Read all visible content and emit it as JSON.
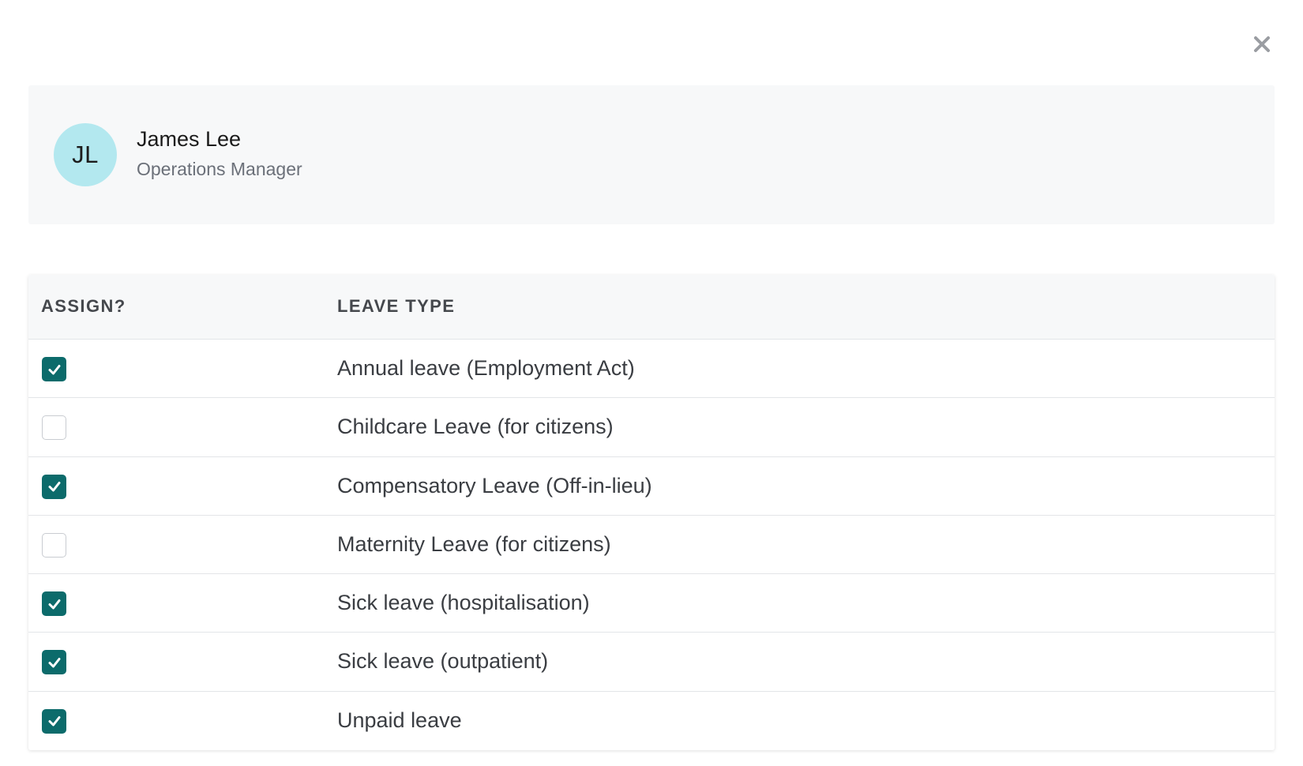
{
  "employee": {
    "initials": "JL",
    "name": "James Lee",
    "role": "Operations Manager",
    "avatar_color": "#b3e8ef"
  },
  "table": {
    "headers": {
      "assign": "ASSIGN?",
      "leave_type": "LEAVE TYPE"
    },
    "rows": [
      {
        "label": "Annual leave (Employment Act)",
        "checked": true
      },
      {
        "label": "Childcare Leave (for citizens)",
        "checked": false
      },
      {
        "label": "Compensatory Leave (Off-in-lieu)",
        "checked": true
      },
      {
        "label": "Maternity Leave (for citizens)",
        "checked": false
      },
      {
        "label": "Sick leave (hospitalisation)",
        "checked": true
      },
      {
        "label": "Sick leave (outpatient)",
        "checked": true
      },
      {
        "label": "Unpaid leave",
        "checked": true
      }
    ]
  },
  "icons": {
    "close": "close-icon",
    "check": "check-icon"
  },
  "colors": {
    "checkbox_checked": "#0c6b6b",
    "close_icon": "#9a9da2"
  }
}
